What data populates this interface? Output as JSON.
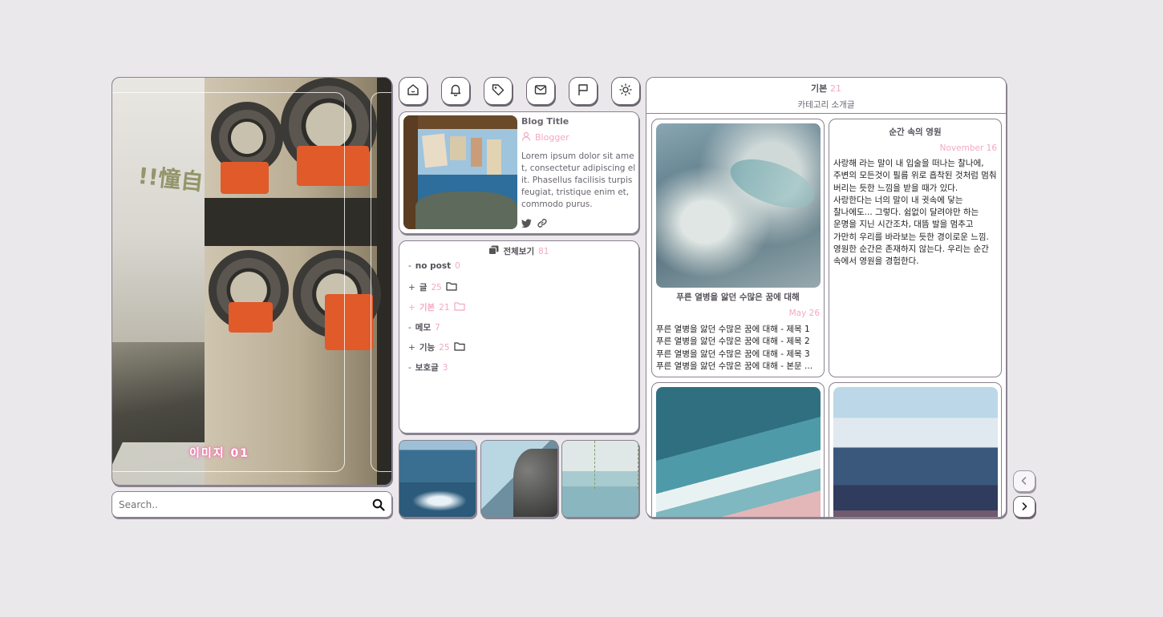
{
  "hero": {
    "caption": "이미지 01",
    "overlay_text": "!!憧自"
  },
  "search": {
    "placeholder": "Search..",
    "icon": "search-icon"
  },
  "toolbar": [
    {
      "icon": "home-icon"
    },
    {
      "icon": "bell-icon"
    },
    {
      "icon": "tag-icon"
    },
    {
      "icon": "mail-icon"
    },
    {
      "icon": "flag-icon"
    },
    {
      "icon": "sun-icon"
    }
  ],
  "profile": {
    "title": "Blog Title",
    "author": "Blogger",
    "description": "Lorem ipsum dolor sit amet, consectetur adipiscing elit. Phasellus facilisis turpis feugiat, tristique enim et, commodo purus.",
    "social": [
      "twitter-icon",
      "link-icon"
    ]
  },
  "category": {
    "header": {
      "label": "전체보기",
      "count": "81"
    },
    "items": [
      {
        "marker": "-",
        "label": "no post",
        "count": "0",
        "folder": false,
        "active": false
      },
      {
        "marker": "+",
        "label": "글",
        "count": "25",
        "folder": true,
        "active": false
      },
      {
        "marker": "+",
        "label": "기본",
        "count": "21",
        "folder": true,
        "active": true
      },
      {
        "marker": "-",
        "label": "메모",
        "count": "7",
        "folder": false,
        "active": false
      },
      {
        "marker": "+",
        "label": "기능",
        "count": "25",
        "folder": true,
        "active": false
      },
      {
        "marker": "-",
        "label": "보호글",
        "count": "3",
        "folder": false,
        "active": false
      }
    ]
  },
  "main": {
    "title": "기본",
    "count": "21",
    "subtitle": "카테고리 소개글",
    "posts": [
      {
        "title": "푸른 열병을 앓던 수많은 꿈에 대해",
        "date": "May 26",
        "lines": [
          "푸른 열병을 앓던 수많은 꿈에 대해 - 제목 1",
          "푸른 열병을 앓던 수많은 꿈에 대해 - 제목 2",
          "푸른 열병을 앓던 수많은 꿈에 대해 - 제목 3",
          "푸른 열병을 앓던 수많은 꿈에 대해 - 본문 ..."
        ]
      },
      {
        "title": "순간 속의 영원",
        "date": "November 16",
        "body": "사랑해 라는 말이 내 입술을 떠나는 찰나에, 주변의 모든것이 필름 위로 흡착된 것처럼 멈춰 버리는 듯한 느낌을 받을 때가 있다. 사랑한다는 너의 말이 내 귓속에 닿는 찰나에도... 그렇다. 쉼없이 달려야만 하는 운명을 지닌 시간조차, 대뜸 발을 멈추고 가만히 우리를 바라보는 듯한 경이로운 느낌. 영원한 순간은 존재하지 않는다. 우리는 순간 속에서 영원을 경험한다."
      }
    ]
  },
  "pager": {
    "prev_icon": "chevron-left-icon",
    "next_icon": "chevron-right-icon"
  },
  "colors": {
    "accent_pink": "#f3a8c4",
    "border": "#8a8290",
    "background": "#ebe8ec"
  }
}
